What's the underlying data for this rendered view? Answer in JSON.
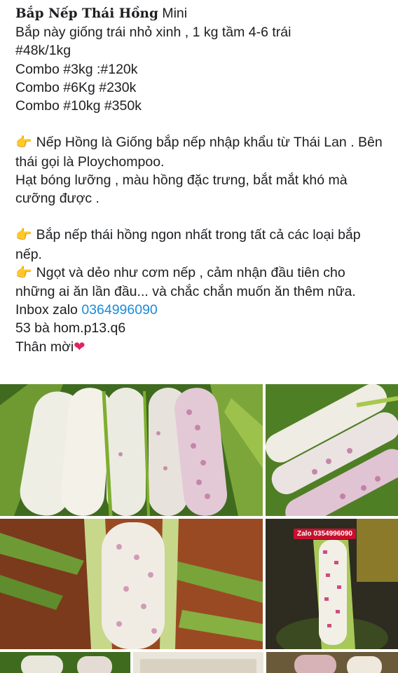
{
  "post": {
    "title_bold": "Bắp Nếp Thái Hồng",
    "title_rest": " Mini",
    "line_intro": "Bắp này giống trái nhỏ xinh , 1 kg tầm 4-6 trái",
    "price_1kg": "#48k/1kg",
    "combo_3kg": "Combo #3kg :#120k",
    "combo_6kg": "Combo #6Kg #230k",
    "combo_10kg": "Combo #10kg #350k",
    "para1_a": "Nếp Hồng là Giống bắp nếp nhập khẩu từ Thái Lan . Bên thái gọi là Ploychompoo.",
    "para1_b": "Hạt bóng lưỡng , màu hồng đặc trưng, bắt mắt khó mà cưỡng được .",
    "para2_a": "Bắp nếp thái hồng ngon nhất trong tất cả các loại bắp nếp.",
    "para2_b": "Ngọt và dẻo như cơm nếp , cảm nhận đầu tiên cho những ai ăn lần đầu... và chắc chắn muốn ăn thêm nữa.",
    "inbox_label": "Inbox zalo ",
    "inbox_phone": "0364996090",
    "address": "53 bà hom.p13.q6",
    "closing": "Thân mời",
    "heart_icon": "❤",
    "pointing_icon": "👉"
  },
  "photos": {
    "tag_text": "Zalo 0354996090"
  },
  "colors": {
    "link": "#1a8bd9",
    "heart": "#e0245e",
    "husk_green": "#5e8f2a",
    "kernel_white": "#f1efe6",
    "kernel_pink": "#b86a98",
    "tag_red": "#c8102e"
  }
}
